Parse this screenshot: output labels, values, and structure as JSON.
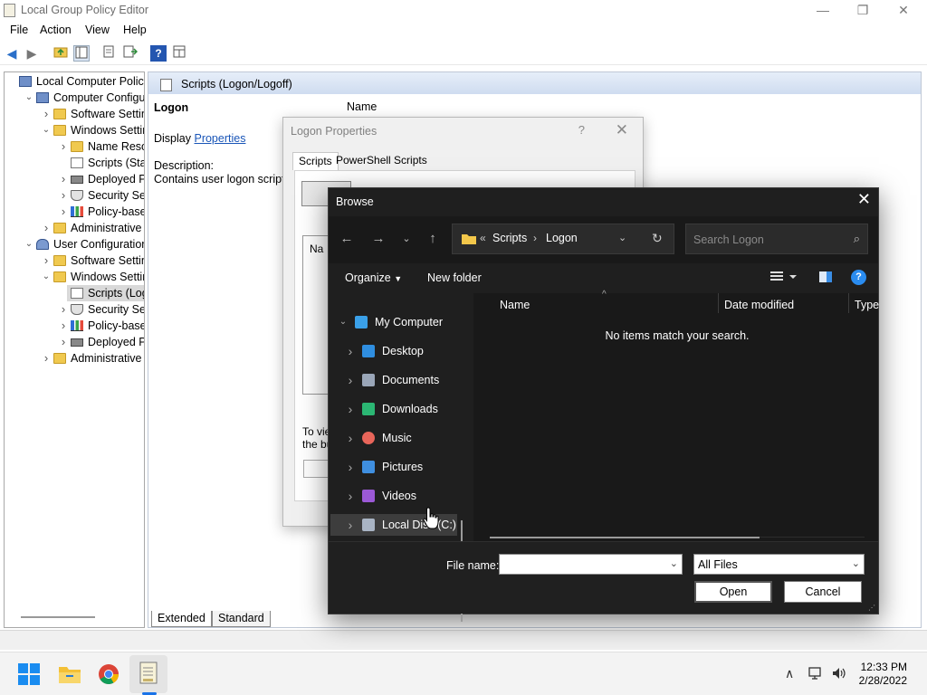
{
  "window": {
    "title": "Local Group Policy Editor",
    "controls": {
      "minimize": "—",
      "maximize": "❐",
      "close": "✕"
    }
  },
  "menu": [
    "File",
    "Action",
    "View",
    "Help"
  ],
  "toolbar": [
    "back-icon",
    "forward-icon",
    "up-folder-icon",
    "show-hide-tree-icon",
    "export-list-icon",
    "properties-icon",
    "help-icon",
    "view-icon"
  ],
  "tree": [
    {
      "label": "Local Computer Policy",
      "depth": 0,
      "expander": "",
      "icon": "computer-icon"
    },
    {
      "label": "Computer Configura",
      "depth": 1,
      "expander": "expanded",
      "icon": "computer-icon"
    },
    {
      "label": "Software Settings",
      "depth": 2,
      "expander": "collapsed",
      "icon": "folder-icon"
    },
    {
      "label": "Windows Setting",
      "depth": 2,
      "expander": "expanded",
      "icon": "folder-icon"
    },
    {
      "label": "Name Resolu",
      "depth": 3,
      "expander": "collapsed",
      "icon": "folder-icon"
    },
    {
      "label": "Scripts (Startu",
      "depth": 3,
      "expander": "",
      "icon": "scripts-icon"
    },
    {
      "label": "Deployed Prir",
      "depth": 3,
      "expander": "collapsed",
      "icon": "printer-icon"
    },
    {
      "label": "Security Settir",
      "depth": 3,
      "expander": "collapsed",
      "icon": "shield-icon"
    },
    {
      "label": "Policy-based",
      "depth": 3,
      "expander": "collapsed",
      "icon": "chart-icon"
    },
    {
      "label": "Administrative Te",
      "depth": 2,
      "expander": "collapsed",
      "icon": "folder-icon"
    },
    {
      "label": "User Configuration",
      "depth": 1,
      "expander": "expanded",
      "icon": "user-icon"
    },
    {
      "label": "Software Settings",
      "depth": 2,
      "expander": "collapsed",
      "icon": "folder-icon"
    },
    {
      "label": "Windows Setting",
      "depth": 2,
      "expander": "expanded",
      "icon": "folder-icon"
    },
    {
      "label": "Scripts (Logon",
      "depth": 3,
      "expander": "",
      "icon": "scripts-icon",
      "selected": true
    },
    {
      "label": "Security Settir",
      "depth": 3,
      "expander": "collapsed",
      "icon": "shield-icon"
    },
    {
      "label": "Policy-based",
      "depth": 3,
      "expander": "collapsed",
      "icon": "chart-icon"
    },
    {
      "label": "Deployed Prir",
      "depth": 3,
      "expander": "collapsed",
      "icon": "printer-icon"
    },
    {
      "label": "Administrative Te",
      "depth": 2,
      "expander": "collapsed",
      "icon": "folder-icon"
    }
  ],
  "details": {
    "header": "Scripts (Logon/Logoff)",
    "item_title": "Logon",
    "display_prefix": "Display",
    "display_link": "Properties",
    "description_label": "Description:",
    "description_text": "Contains user logon scripts",
    "column_name": "Name",
    "tabs": [
      "Extended",
      "Standard"
    ]
  },
  "logon_properties": {
    "title": "Logon Properties",
    "help": "?",
    "close": "✕",
    "tabs": [
      "Scripts",
      "PowerShell Scripts"
    ],
    "list_header": "Na",
    "hint_line1": "To vie",
    "hint_line2": "the bu"
  },
  "browse": {
    "title": "Browse",
    "close": "✕",
    "breadcrumb": {
      "prefix": "«",
      "path": [
        "Scripts",
        "Logon"
      ],
      "separator": "›"
    },
    "search_placeholder": "Search Logon",
    "organize": "Organize",
    "new_folder": "New folder",
    "nav": [
      {
        "label": "My Computer",
        "icon": "computer-icon",
        "color": "#3aa0e8",
        "expander": "expanded",
        "level": 0
      },
      {
        "label": "Desktop",
        "icon": "desktop-icon",
        "color": "#2f8ee0",
        "expander": "collapsed",
        "level": 1
      },
      {
        "label": "Documents",
        "icon": "documents-icon",
        "color": "#9aa6b8",
        "expander": "collapsed",
        "level": 1
      },
      {
        "label": "Downloads",
        "icon": "downloads-icon",
        "color": "#2bb673",
        "expander": "collapsed",
        "level": 1
      },
      {
        "label": "Music",
        "icon": "music-icon",
        "color": "#e8655a",
        "expander": "collapsed",
        "level": 1
      },
      {
        "label": "Pictures",
        "icon": "pictures-icon",
        "color": "#3f8fe0",
        "expander": "collapsed",
        "level": 1
      },
      {
        "label": "Videos",
        "icon": "videos-icon",
        "color": "#9b59d6",
        "expander": "collapsed",
        "level": 1
      },
      {
        "label": "Local Disk (C:)",
        "icon": "drive-icon",
        "color": "#a9b4c4",
        "expander": "collapsed",
        "level": 1,
        "hover": true
      }
    ],
    "columns": [
      "Name",
      "Date modified",
      "Type"
    ],
    "empty_message": "No items match your search.",
    "file_name_label": "File name:",
    "file_name_value": "",
    "file_type": "All Files",
    "open": "Open",
    "cancel": "Cancel"
  },
  "taskbar": {
    "apps": [
      "start-icon",
      "file-explorer-icon",
      "chrome-icon",
      "group-policy-editor-icon"
    ],
    "time": "12:33 PM",
    "date": "2/28/2022"
  },
  "colors": {
    "accent": "#0078d4",
    "dark_bg": "#1f1f1f",
    "link": "#1a56b8"
  }
}
